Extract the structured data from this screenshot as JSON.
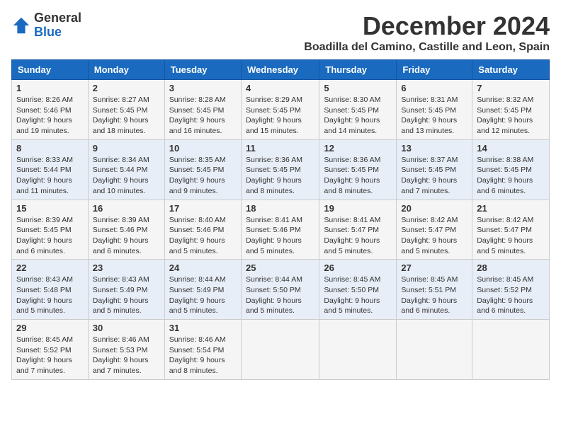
{
  "logo": {
    "general": "General",
    "blue": "Blue"
  },
  "title": "December 2024",
  "subtitle": "Boadilla del Camino, Castille and Leon, Spain",
  "days_of_week": [
    "Sunday",
    "Monday",
    "Tuesday",
    "Wednesday",
    "Thursday",
    "Friday",
    "Saturday"
  ],
  "weeks": [
    [
      {
        "day": "1",
        "sunrise": "8:26 AM",
        "sunset": "5:46 PM",
        "daylight": "9 hours and 19 minutes."
      },
      {
        "day": "2",
        "sunrise": "8:27 AM",
        "sunset": "5:45 PM",
        "daylight": "9 hours and 18 minutes."
      },
      {
        "day": "3",
        "sunrise": "8:28 AM",
        "sunset": "5:45 PM",
        "daylight": "9 hours and 16 minutes."
      },
      {
        "day": "4",
        "sunrise": "8:29 AM",
        "sunset": "5:45 PM",
        "daylight": "9 hours and 15 minutes."
      },
      {
        "day": "5",
        "sunrise": "8:30 AM",
        "sunset": "5:45 PM",
        "daylight": "9 hours and 14 minutes."
      },
      {
        "day": "6",
        "sunrise": "8:31 AM",
        "sunset": "5:45 PM",
        "daylight": "9 hours and 13 minutes."
      },
      {
        "day": "7",
        "sunrise": "8:32 AM",
        "sunset": "5:45 PM",
        "daylight": "9 hours and 12 minutes."
      }
    ],
    [
      {
        "day": "8",
        "sunrise": "8:33 AM",
        "sunset": "5:44 PM",
        "daylight": "9 hours and 11 minutes."
      },
      {
        "day": "9",
        "sunrise": "8:34 AM",
        "sunset": "5:44 PM",
        "daylight": "9 hours and 10 minutes."
      },
      {
        "day": "10",
        "sunrise": "8:35 AM",
        "sunset": "5:45 PM",
        "daylight": "9 hours and 9 minutes."
      },
      {
        "day": "11",
        "sunrise": "8:36 AM",
        "sunset": "5:45 PM",
        "daylight": "9 hours and 8 minutes."
      },
      {
        "day": "12",
        "sunrise": "8:36 AM",
        "sunset": "5:45 PM",
        "daylight": "9 hours and 8 minutes."
      },
      {
        "day": "13",
        "sunrise": "8:37 AM",
        "sunset": "5:45 PM",
        "daylight": "9 hours and 7 minutes."
      },
      {
        "day": "14",
        "sunrise": "8:38 AM",
        "sunset": "5:45 PM",
        "daylight": "9 hours and 6 minutes."
      }
    ],
    [
      {
        "day": "15",
        "sunrise": "8:39 AM",
        "sunset": "5:45 PM",
        "daylight": "9 hours and 6 minutes."
      },
      {
        "day": "16",
        "sunrise": "8:39 AM",
        "sunset": "5:46 PM",
        "daylight": "9 hours and 6 minutes."
      },
      {
        "day": "17",
        "sunrise": "8:40 AM",
        "sunset": "5:46 PM",
        "daylight": "9 hours and 5 minutes."
      },
      {
        "day": "18",
        "sunrise": "8:41 AM",
        "sunset": "5:46 PM",
        "daylight": "9 hours and 5 minutes."
      },
      {
        "day": "19",
        "sunrise": "8:41 AM",
        "sunset": "5:47 PM",
        "daylight": "9 hours and 5 minutes."
      },
      {
        "day": "20",
        "sunrise": "8:42 AM",
        "sunset": "5:47 PM",
        "daylight": "9 hours and 5 minutes."
      },
      {
        "day": "21",
        "sunrise": "8:42 AM",
        "sunset": "5:47 PM",
        "daylight": "9 hours and 5 minutes."
      }
    ],
    [
      {
        "day": "22",
        "sunrise": "8:43 AM",
        "sunset": "5:48 PM",
        "daylight": "9 hours and 5 minutes."
      },
      {
        "day": "23",
        "sunrise": "8:43 AM",
        "sunset": "5:49 PM",
        "daylight": "9 hours and 5 minutes."
      },
      {
        "day": "24",
        "sunrise": "8:44 AM",
        "sunset": "5:49 PM",
        "daylight": "9 hours and 5 minutes."
      },
      {
        "day": "25",
        "sunrise": "8:44 AM",
        "sunset": "5:50 PM",
        "daylight": "9 hours and 5 minutes."
      },
      {
        "day": "26",
        "sunrise": "8:45 AM",
        "sunset": "5:50 PM",
        "daylight": "9 hours and 5 minutes."
      },
      {
        "day": "27",
        "sunrise": "8:45 AM",
        "sunset": "5:51 PM",
        "daylight": "9 hours and 6 minutes."
      },
      {
        "day": "28",
        "sunrise": "8:45 AM",
        "sunset": "5:52 PM",
        "daylight": "9 hours and 6 minutes."
      }
    ],
    [
      {
        "day": "29",
        "sunrise": "8:45 AM",
        "sunset": "5:52 PM",
        "daylight": "9 hours and 7 minutes."
      },
      {
        "day": "30",
        "sunrise": "8:46 AM",
        "sunset": "5:53 PM",
        "daylight": "9 hours and 7 minutes."
      },
      {
        "day": "31",
        "sunrise": "8:46 AM",
        "sunset": "5:54 PM",
        "daylight": "9 hours and 8 minutes."
      },
      null,
      null,
      null,
      null
    ]
  ]
}
